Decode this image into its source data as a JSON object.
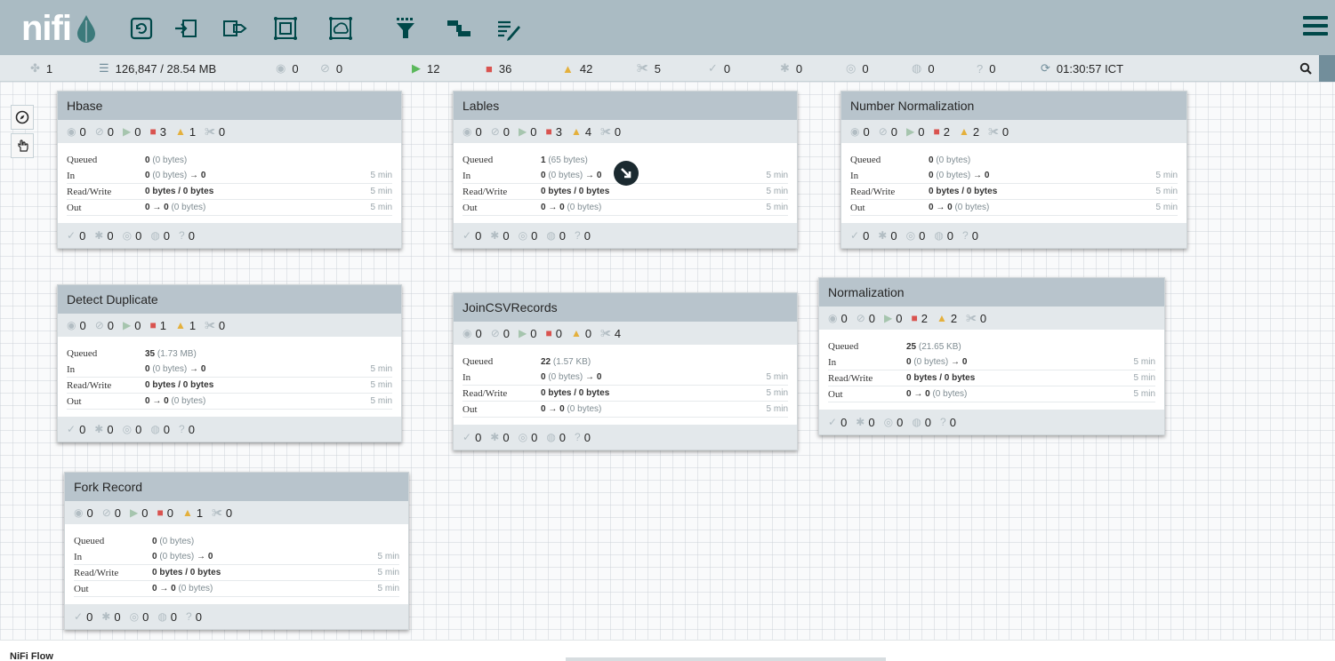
{
  "app": {
    "logo": "nifi"
  },
  "toolbar": {
    "buttons": [
      "processor-icon",
      "input-port-icon",
      "output-port-icon",
      "process-group-icon",
      "remote-process-group-icon",
      "funnel-icon",
      "template-icon",
      "label-icon"
    ]
  },
  "status": {
    "cluster": "1",
    "flowfiles": "126,847 / 28.54 MB",
    "transmitting": "0",
    "not_transmitting": "0",
    "running": "12",
    "stopped": "36",
    "invalid": "42",
    "disabled": "5",
    "up_to_date": "0",
    "locally_modified": "0",
    "stale": "0",
    "locally_modified_stale": "0",
    "sync_failure": "0",
    "refresh_time": "01:30:57 ICT"
  },
  "process_groups": [
    {
      "name": "Hbase",
      "stats": [
        "0",
        "0",
        "0",
        "3",
        "1",
        "0"
      ],
      "queued": "0",
      "queued_size": "(0 bytes)",
      "in": "0",
      "in_size": "(0 bytes)",
      "in_arrow": "→",
      "in_dest": "0",
      "in_time": "5 min",
      "rw": "0 bytes / 0 bytes",
      "rw_time": "5 min",
      "out": "0",
      "out_arrow": "→",
      "out_count": "0",
      "out_size": "(0 bytes)",
      "out_time": "5 min",
      "footer": [
        "0",
        "0",
        "0",
        "0",
        "0"
      ]
    },
    {
      "name": "Lables",
      "stats": [
        "0",
        "0",
        "0",
        "3",
        "4",
        "0"
      ],
      "queued": "1",
      "queued_size": "(65 bytes)",
      "in": "0",
      "in_size": "(0 bytes)",
      "in_arrow": "→",
      "in_dest": "0",
      "in_time": "5 min",
      "rw": "0 bytes / 0 bytes",
      "rw_time": "5 min",
      "out": "0",
      "out_arrow": "→",
      "out_count": "0",
      "out_size": "(0 bytes)",
      "out_time": "5 min",
      "footer": [
        "0",
        "0",
        "0",
        "0",
        "0"
      ]
    },
    {
      "name": "Number Normalization",
      "stats": [
        "0",
        "0",
        "0",
        "2",
        "2",
        "0"
      ],
      "queued": "0",
      "queued_size": "(0 bytes)",
      "in": "0",
      "in_size": "(0 bytes)",
      "in_arrow": "→",
      "in_dest": "0",
      "in_time": "5 min",
      "rw": "0 bytes / 0 bytes",
      "rw_time": "5 min",
      "out": "0",
      "out_arrow": "→",
      "out_count": "0",
      "out_size": "(0 bytes)",
      "out_time": "5 min",
      "footer": [
        "0",
        "0",
        "0",
        "0",
        "0"
      ]
    },
    {
      "name": "Detect Duplicate",
      "stats": [
        "0",
        "0",
        "0",
        "1",
        "1",
        "0"
      ],
      "queued": "35",
      "queued_size": "(1.73 MB)",
      "in": "0",
      "in_size": "(0 bytes)",
      "in_arrow": "→",
      "in_dest": "0",
      "in_time": "5 min",
      "rw": "0 bytes / 0 bytes",
      "rw_time": "5 min",
      "out": "0",
      "out_arrow": "→",
      "out_count": "0",
      "out_size": "(0 bytes)",
      "out_time": "5 min",
      "footer": [
        "0",
        "0",
        "0",
        "0",
        "0"
      ]
    },
    {
      "name": "JoinCSVRecords",
      "stats": [
        "0",
        "0",
        "0",
        "0",
        "0",
        "4"
      ],
      "queued": "22",
      "queued_size": "(1.57 KB)",
      "in": "0",
      "in_size": "(0 bytes)",
      "in_arrow": "→",
      "in_dest": "0",
      "in_time": "5 min",
      "rw": "0 bytes / 0 bytes",
      "rw_time": "5 min",
      "out": "0",
      "out_arrow": "→",
      "out_count": "0",
      "out_size": "(0 bytes)",
      "out_time": "5 min",
      "footer": [
        "0",
        "0",
        "0",
        "0",
        "0"
      ]
    },
    {
      "name": "Normalization",
      "stats": [
        "0",
        "0",
        "0",
        "2",
        "2",
        "0"
      ],
      "queued": "25",
      "queued_size": "(21.65 KB)",
      "in": "0",
      "in_size": "(0 bytes)",
      "in_arrow": "→",
      "in_dest": "0",
      "in_time": "5 min",
      "rw": "0 bytes / 0 bytes",
      "rw_time": "5 min",
      "out": "0",
      "out_arrow": "→",
      "out_count": "0",
      "out_size": "(0 bytes)",
      "out_time": "5 min",
      "footer": [
        "0",
        "0",
        "0",
        "0",
        "0"
      ]
    },
    {
      "name": "Fork Record",
      "stats": [
        "0",
        "0",
        "0",
        "0",
        "1",
        "0"
      ],
      "queued": "0",
      "queued_size": "(0 bytes)",
      "in": "0",
      "in_size": "(0 bytes)",
      "in_arrow": "→",
      "in_dest": "0",
      "in_time": "5 min",
      "rw": "0 bytes / 0 bytes",
      "rw_time": "5 min",
      "out": "0",
      "out_arrow": "→",
      "out_count": "0",
      "out_size": "(0 bytes)",
      "out_time": "5 min",
      "footer": [
        "0",
        "0",
        "0",
        "0",
        "0"
      ]
    }
  ],
  "labels": {
    "queued": "Queued",
    "in": "In",
    "rw": "Read/Write",
    "out": "Out"
  },
  "breadcrumb": {
    "current": "NiFi Flow"
  },
  "colors": {
    "header": "#aabbc3",
    "accent": "#004849",
    "stopped": "#d9534f",
    "invalid": "#e4b03c",
    "running": "#a6c5ae"
  }
}
